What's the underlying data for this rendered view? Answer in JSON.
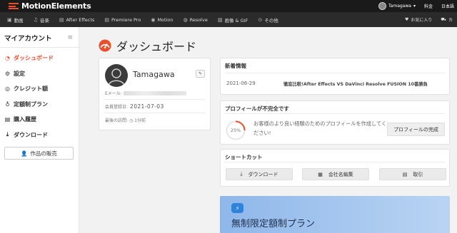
{
  "header": {
    "brand": "MotionElements",
    "user_name": "Tamagawa",
    "points": "料金",
    "language": "日本語"
  },
  "nav": {
    "items": [
      {
        "label": "動画",
        "icon": "video-icon"
      },
      {
        "label": "音楽",
        "icon": "music-icon"
      },
      {
        "label": "After Effects",
        "icon": "after-effects-icon"
      },
      {
        "label": "Premiere Pro",
        "icon": "premiere-icon"
      },
      {
        "label": "Motion",
        "icon": "motion-icon"
      },
      {
        "label": "Resolve",
        "icon": "resolve-icon"
      },
      {
        "label": "画像 & GIF",
        "icon": "image-icon"
      },
      {
        "label": "その他",
        "icon": "more-icon"
      }
    ],
    "favorites": "お気に入り",
    "cart": "カ"
  },
  "sidebar": {
    "title": "マイアカウント",
    "items": [
      {
        "label": "ダッシュボード",
        "icon": "dashboard-icon",
        "active": true
      },
      {
        "label": "設定",
        "icon": "gear-icon"
      },
      {
        "label": "クレジット額",
        "icon": "credit-icon"
      },
      {
        "label": "定額制プラン",
        "icon": "bulb-icon"
      },
      {
        "label": "購入履歴",
        "icon": "receipt-icon"
      },
      {
        "label": "ダウンロード",
        "icon": "download-icon"
      }
    ],
    "sell_label": "作品の販売"
  },
  "main": {
    "title": "ダッシュボード",
    "profile": {
      "name": "Tamagawa",
      "email_label": "Eメール:",
      "registered_label": "会員登録日:",
      "registered_date": "2021-07-03",
      "last_visit_label": "最後の訪問:",
      "last_visit_value": "1分前"
    },
    "news": {
      "title": "新着情報",
      "date": "2021-06-29",
      "text": "徹底比較!After Effects VS DaVinci Resolve FUSION 10番勝負"
    },
    "incomplete": {
      "title": "プロフィールが不完全です",
      "percent": 25,
      "percent_label": "25%",
      "text": "お客様のより良い経験のためのプロフィールを作成してください!",
      "button": "プロフィールの完成"
    },
    "shortcut": {
      "title": "ショートカット",
      "buttons": [
        {
          "label": "ダウンロード",
          "icon": "download-icon"
        },
        {
          "label": "会社名編集",
          "icon": "building-icon"
        },
        {
          "label": "取引",
          "icon": "receipt-icon"
        }
      ]
    },
    "plan": {
      "title": "無制限定額制プラン"
    }
  },
  "colors": {
    "accent": "#e8502d",
    "topbar": "#1a1a1a",
    "navbar": "#2b2b2b",
    "plan_blue": "#2d84d8"
  }
}
